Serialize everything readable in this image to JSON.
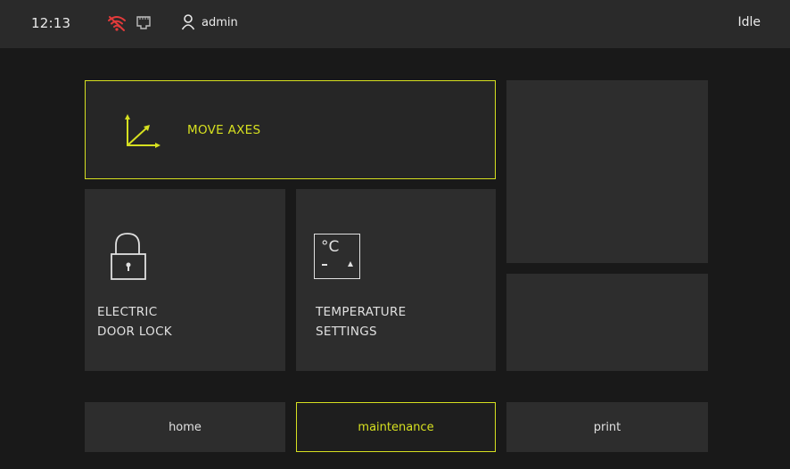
{
  "status_bar": {
    "time": "12:13",
    "user": "admin",
    "status": "Idle",
    "icons": [
      "wifi-off-icon",
      "ethernet-icon",
      "user-icon"
    ],
    "wifi_color": "#e23b3b"
  },
  "tiles": {
    "move_axes": {
      "label": "MOVE AXES",
      "icon": "axes-icon",
      "selected": true
    },
    "door_lock": {
      "line1": "ELECTRIC",
      "line2": "DOOR LOCK",
      "icon": "padlock-icon"
    },
    "temperature": {
      "line1": "TEMPERATURE",
      "line2": "SETTINGS",
      "icon": "thermometer-celsius-icon",
      "icon_text": "°C"
    }
  },
  "nav": {
    "items": [
      {
        "label": "home",
        "active": false
      },
      {
        "label": "maintenance",
        "active": true
      },
      {
        "label": "print",
        "active": false
      }
    ]
  },
  "colors": {
    "accent": "#d6e020",
    "background": "#191919",
    "tile": "#2d2d2d"
  }
}
